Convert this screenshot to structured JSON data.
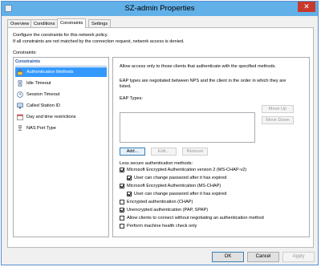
{
  "window": {
    "title": "SZ-admin Properties",
    "close_glyph": "✕"
  },
  "tabs": [
    {
      "label": "Overview",
      "active": false
    },
    {
      "label": "Conditions",
      "active": false
    },
    {
      "label": "Constraints",
      "active": true
    },
    {
      "label": "Settings",
      "active": false
    }
  ],
  "description": {
    "line1": "Configure the constraints for this network policy.",
    "line2": "If all constraints are not matched by the connection request, network access is denied."
  },
  "constraints_label": "Constraints:",
  "left_panel": {
    "header": "Constraints",
    "items": [
      {
        "label": "Authentication Methods",
        "icon": "lock-key-icon",
        "selected": true
      },
      {
        "label": "Idle Timeout",
        "icon": "timer-icon",
        "selected": false
      },
      {
        "label": "Session Timeout",
        "icon": "clock-icon",
        "selected": false
      },
      {
        "label": "Called Station ID",
        "icon": "monitor-icon",
        "selected": false
      },
      {
        "label": "Day and time restrictions",
        "icon": "calendar-icon",
        "selected": false
      },
      {
        "label": "NAS Port Type",
        "icon": "network-port-icon",
        "selected": false
      }
    ]
  },
  "right_panel": {
    "intro": "Allow access only to those clients that authenticate with the specified methods.",
    "eap_note_line1": "EAP types are negotiated between NPS and the client in the order in which they are",
    "eap_note_line2": "listed.",
    "eap_types_label": "EAP Types:",
    "buttons": {
      "move_up": "Move Up",
      "move_down": "Move Down",
      "add": "Add...",
      "edit": "Edit...",
      "remove": "Remove"
    },
    "less_secure_label": "Less secure authentication methods:",
    "methods": [
      {
        "label": "Microsoft Encrypted Authentication version 2 (MS-CHAP-v2)",
        "checked": true,
        "indent": false
      },
      {
        "label": "User can change password after it has expired",
        "checked": true,
        "indent": true
      },
      {
        "label": "Microsoft Encrypted Authentication (MS-CHAP)",
        "checked": true,
        "indent": false
      },
      {
        "label": "User can change password after it has expired",
        "checked": true,
        "indent": true
      },
      {
        "label": "Encrypted authentication (CHAP)",
        "checked": false,
        "indent": false
      },
      {
        "label": "Unencrypted authentication (PAP, SPAP)",
        "checked": true,
        "indent": false
      },
      {
        "label": "Allow clients to connect without negotiating an authentication method",
        "checked": false,
        "indent": false
      },
      {
        "label": "Perform machine health check only",
        "checked": false,
        "indent": false
      }
    ]
  },
  "footer": {
    "ok": "OK",
    "cancel": "Cancel",
    "apply": "Apply"
  },
  "colors": {
    "titlebar": "#62b0e8",
    "selection": "#3399ff",
    "close": "#c7392b"
  }
}
